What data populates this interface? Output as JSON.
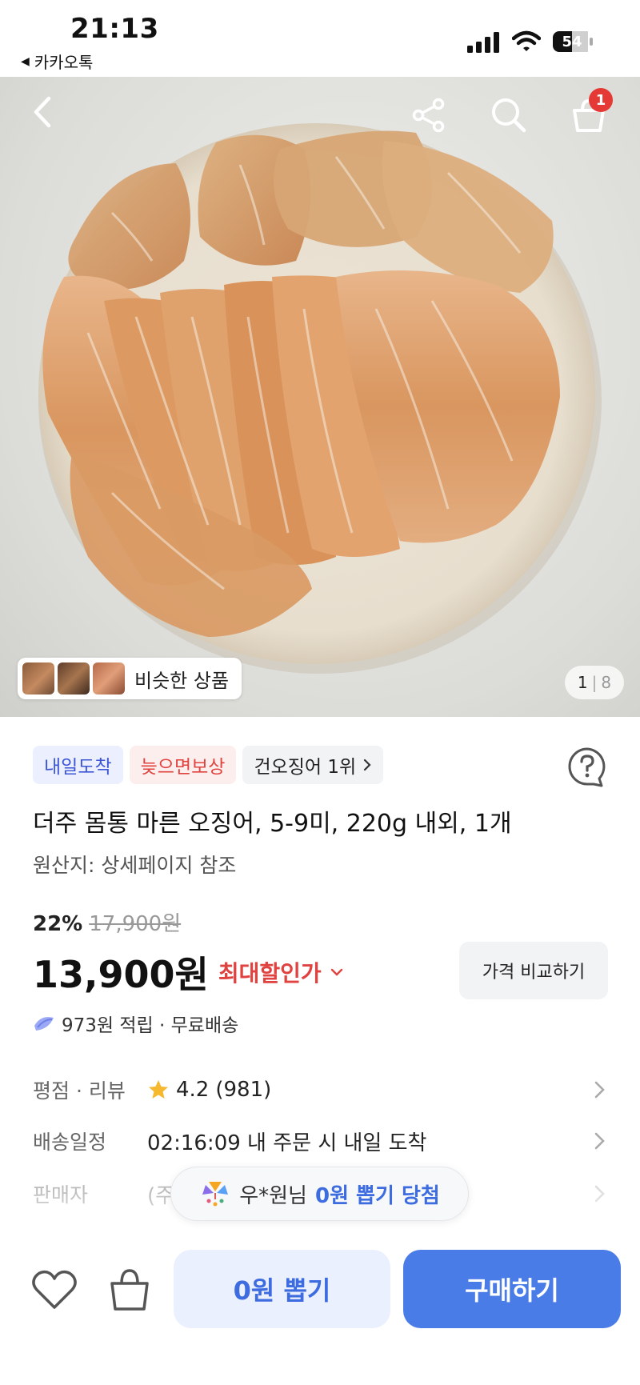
{
  "status_bar": {
    "time": "21:13",
    "back_app": "카카오톡",
    "battery": "54"
  },
  "hero": {
    "cart_count": "1",
    "similar_label": "비슷한 상품",
    "page_current": "1",
    "page_separator": "|",
    "page_total": "8"
  },
  "badges": [
    {
      "label": "내일도착"
    },
    {
      "label": "늦으면보상"
    },
    {
      "label": "건오징어 1위"
    }
  ],
  "product": {
    "title": "더주 몸통 마른 오징어, 5-9미, 220g 내외, 1개",
    "origin": "원산지: 상세페이지 참조",
    "discount": "22%",
    "old_price": "17,900원",
    "price": "13,900원",
    "max_discount_label": "최대할인가",
    "compare_label": "가격 비교하기",
    "reward_text": "973원 적립 · 무료배송"
  },
  "info": {
    "rating_label": "평점 · 리뷰",
    "rating_value": "4.2",
    "review_count": "(981)",
    "delivery_label": "배송일정",
    "delivery_value": "02:16:09 내 주문 시 내일 도착",
    "seller_label": "판매자",
    "seller_value": "(주"
  },
  "toast": {
    "name": "우*원님",
    "win": "0원 뽑기 당첨"
  },
  "bottom": {
    "draw_label": "0원 뽑기",
    "buy_label": "구매하기"
  },
  "colors": {
    "accent_blue": "#4a7ce8",
    "badge_red": "#e0433f",
    "star": "#f5b82e"
  }
}
